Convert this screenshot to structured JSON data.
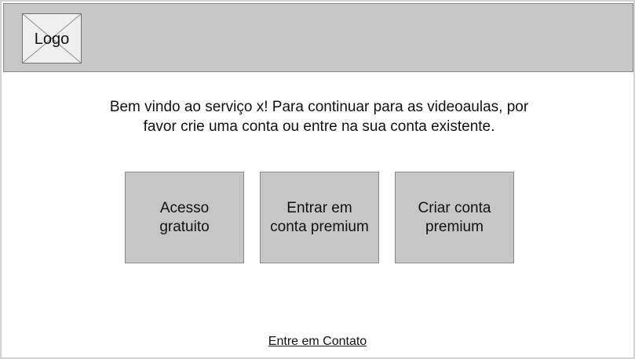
{
  "header": {
    "logo_label": "Logo"
  },
  "welcome": {
    "line1": "Bem vindo ao serviço x! Para continuar para as videoaulas, por",
    "line2": "favor crie uma conta ou entre na sua conta existente."
  },
  "options": [
    {
      "label": "Acesso\ngratuito"
    },
    {
      "label": "Entrar em\nconta premium"
    },
    {
      "label": "Criar conta\npremium"
    }
  ],
  "footer": {
    "contact_label": "Entre em Contato"
  },
  "colors": {
    "header_bg": "#c6c6c6",
    "button_bg": "#c6c6c6",
    "border": "#8a8a8a",
    "text": "#111111"
  }
}
